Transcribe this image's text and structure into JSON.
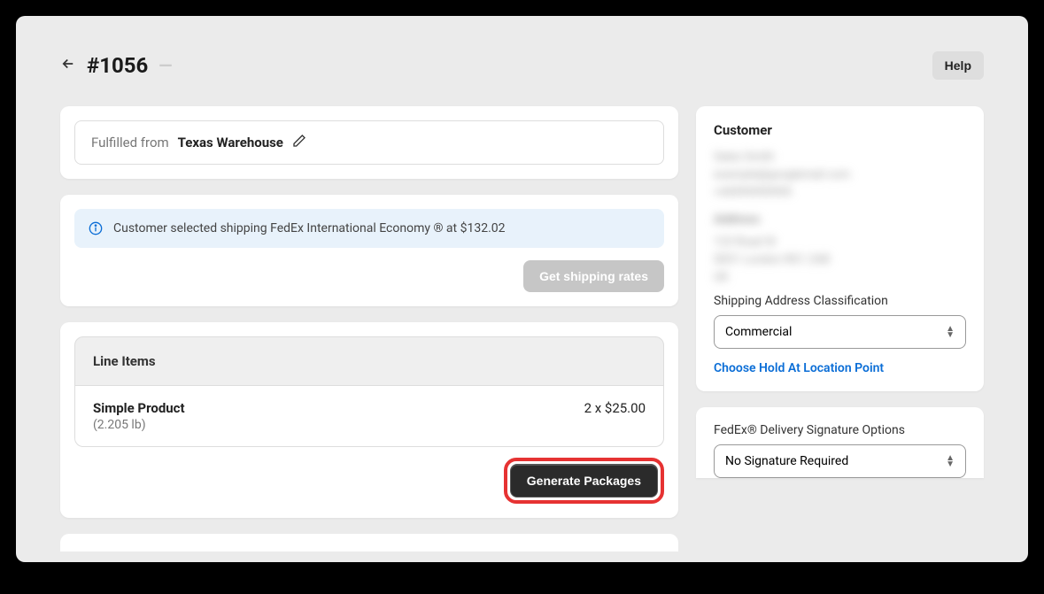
{
  "header": {
    "order_title": "#1056",
    "help_button": "Help"
  },
  "fulfillment": {
    "label": "Fulfilled from",
    "value": "Texas Warehouse"
  },
  "shipping_info": {
    "banner_text": "Customer selected shipping FedEx International Economy ®  at  $132.02",
    "rates_button": "Get shipping rates"
  },
  "line_items": {
    "heading": "Line Items",
    "items": [
      {
        "name": "Simple Product",
        "weight": "(2.205 lb)",
        "price": "2 x $25.00"
      }
    ],
    "generate_button": "Generate Packages"
  },
  "customer": {
    "heading": "Customer",
    "name": "Sales Smith",
    "email": "example@googlemail.com",
    "phone": "+44999999999",
    "address_heading": "Address",
    "addr1": "123 Road St",
    "addr2": "SE01 London RG1 2AB",
    "addr3": "UK",
    "classification_label": "Shipping Address Classification",
    "classification_value": "Commercial",
    "hold_link": "Choose Hold At Location Point"
  },
  "signature": {
    "heading": "FedEx® Delivery Signature Options",
    "value": "No Signature Required"
  }
}
